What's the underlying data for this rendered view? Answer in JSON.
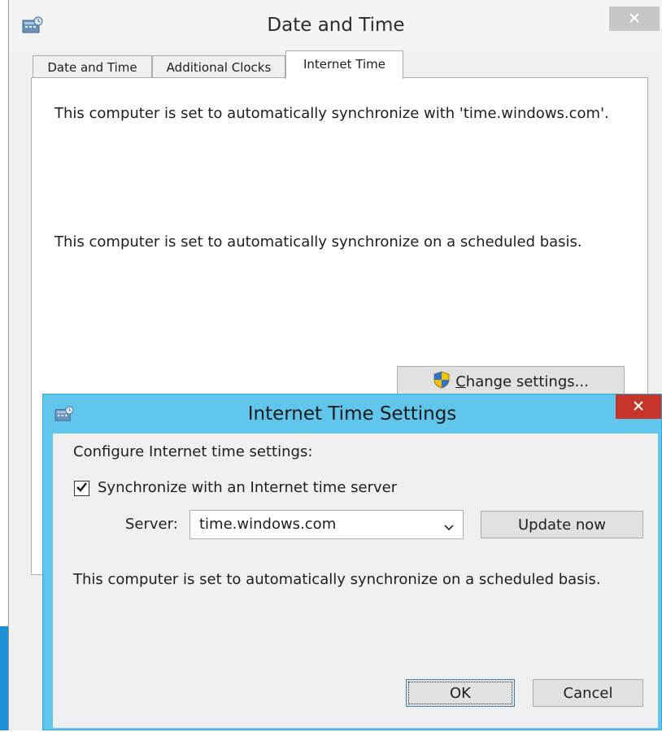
{
  "outer_window": {
    "title": "Date and Time",
    "tabs": [
      {
        "label": "Date and Time"
      },
      {
        "label": "Additional Clocks"
      },
      {
        "label": "Internet Time"
      }
    ],
    "active_tab": "Internet Time",
    "panel": {
      "sync_server_text": "This computer is set to automatically synchronize with 'time.windows.com'.",
      "sync_schedule_text": "This computer is set to automatically synchronize on a scheduled basis.",
      "change_settings_mnemonic": "C",
      "change_settings_rest": "hange settings..."
    }
  },
  "dialog": {
    "title": "Internet Time Settings",
    "configure_label": "Configure Internet time settings:",
    "sync_checkbox": {
      "label": "Synchronize with an Internet time server",
      "checked": true
    },
    "server_label": "Server:",
    "server_value": "time.windows.com",
    "update_now_label": "Update now",
    "status_text": "This computer is set to automatically synchronize on a scheduled basis.",
    "ok_label": "OK",
    "cancel_label": "Cancel"
  },
  "icons": {
    "app": "date-time-app-icon",
    "close": "close-icon",
    "shield": "uac-shield-icon",
    "checkmark": "checkmark-icon",
    "dropdown": "chevron-down-icon"
  },
  "colors": {
    "dialog_frame": "#61c6ec",
    "close_active": "#c7352a",
    "close_inactive": "#c7c7c7",
    "desktop": "#1f8fd6"
  }
}
